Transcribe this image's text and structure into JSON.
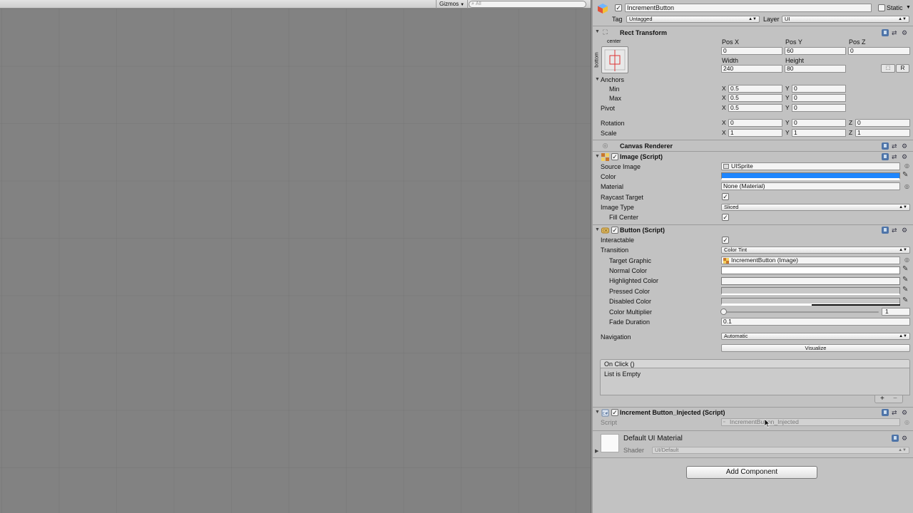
{
  "scene": {
    "gizmos_label": "Gizmos",
    "search_placeholder": "All"
  },
  "gameobject": {
    "name": "IncrementButton",
    "static_label": "Static",
    "tag_label": "Tag",
    "tag_value": "Untagged",
    "layer_label": "Layer",
    "layer_value": "UI"
  },
  "rect_transform": {
    "title": "Rect Transform",
    "anchor_preset_top": "center",
    "anchor_preset_side": "bottom",
    "pos_x_label": "Pos X",
    "pos_y_label": "Pos Y",
    "pos_z_label": "Pos Z",
    "pos_x": "0",
    "pos_y": "60",
    "pos_z": "0",
    "width_label": "Width",
    "height_label": "Height",
    "width": "240",
    "height": "80",
    "r_button": "R",
    "anchors_label": "Anchors",
    "min_label": "Min",
    "max_label": "Max",
    "min_x": "0.5",
    "min_y": "0",
    "max_x": "0.5",
    "max_y": "0",
    "pivot_label": "Pivot",
    "pivot_x": "0.5",
    "pivot_y": "0",
    "rotation_label": "Rotation",
    "rot_x": "0",
    "rot_y": "0",
    "rot_z": "0",
    "scale_label": "Scale",
    "scale_x": "1",
    "scale_y": "1",
    "scale_z": "1",
    "x": "X",
    "y": "Y",
    "z": "Z"
  },
  "canvas_renderer": {
    "title": "Canvas Renderer"
  },
  "image": {
    "title": "Image (Script)",
    "source_image_label": "Source Image",
    "source_image": "UISprite",
    "color_label": "Color",
    "color_value": "#1e86ff",
    "material_label": "Material",
    "material": "None (Material)",
    "raycast_label": "Raycast Target",
    "image_type_label": "Image Type",
    "image_type": "Sliced",
    "fill_center_label": "Fill Center"
  },
  "button": {
    "title": "Button (Script)",
    "interactable_label": "Interactable",
    "transition_label": "Transition",
    "transition": "Color Tint",
    "target_graphic_label": "Target Graphic",
    "target_graphic": "IncrementButton (Image)",
    "normal_color_label": "Normal Color",
    "highlighted_color_label": "Highlighted Color",
    "pressed_color_label": "Pressed Color",
    "disabled_color_label": "Disabled Color",
    "color_multiplier_label": "Color Multiplier",
    "color_multiplier": "1",
    "fade_duration_label": "Fade Duration",
    "fade_duration": "0.1",
    "navigation_label": "Navigation",
    "navigation": "Automatic",
    "visualize_label": "Visualize",
    "onclick_title": "On Click ()",
    "onclick_empty": "List is Empty",
    "plus": "+",
    "minus": "−"
  },
  "increment_script": {
    "title": "Increment Button_Injected (Script)",
    "script_label": "Script",
    "script_value": "IncrementButton_Injected"
  },
  "material": {
    "title": "Default UI Material",
    "shader_label": "Shader",
    "shader_value": "UI/Default"
  },
  "add_component_label": "Add Component",
  "colors": {
    "normal": "#ffffff",
    "highlighted": "#f5f5f5",
    "pressed": "#c8c8c8",
    "disabled": "#c8c8c8"
  }
}
